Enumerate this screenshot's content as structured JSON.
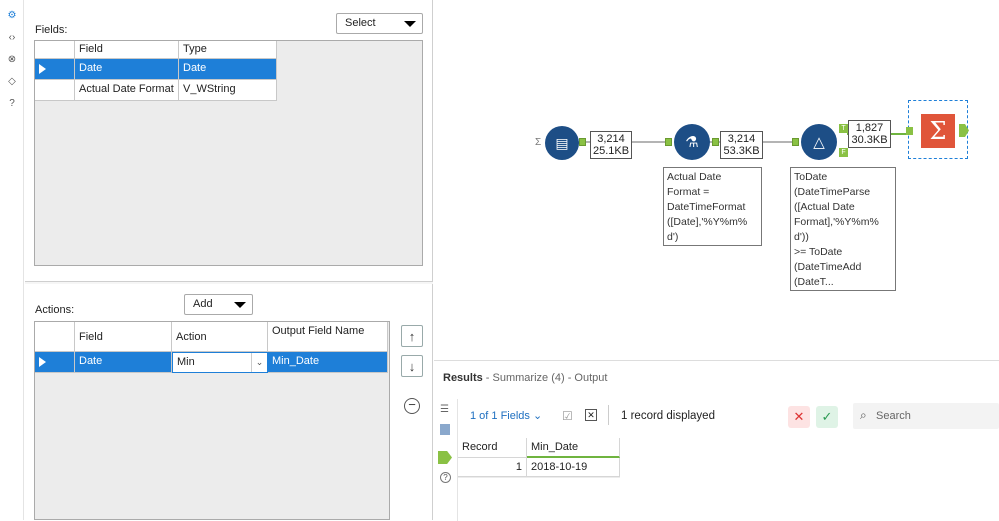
{
  "left_panel": {
    "fields_label": "Fields:",
    "select_dropdown": "Select",
    "fields_table": {
      "headers": [
        "Field",
        "Type"
      ],
      "rows": [
        {
          "field": "Date",
          "type": "Date"
        },
        {
          "field": "Actual Date Format",
          "type": "V_WString"
        }
      ]
    },
    "actions_label": "Actions:",
    "add_dropdown": "Add",
    "actions_table": {
      "headers": [
        "Field",
        "Action",
        "Output Field Name"
      ],
      "rows": [
        {
          "field": "Date",
          "action": "Min",
          "output": "Min_Date"
        }
      ]
    }
  },
  "canvas": {
    "conn1": {
      "line1": "3,214",
      "line2": "25.1KB"
    },
    "conn2": {
      "line1": "3,214",
      "line2": "53.3KB"
    },
    "conn3": {
      "line1": "1,827",
      "line2": "30.3KB"
    },
    "formula_annotation": "Actual Date\nFormat =\nDateTimeFormat\n([Date],'%Y%m%\nd')",
    "filter_annotation": "ToDate\n(DateTimeParse\n([Actual Date\nFormat],'%Y%m%\nd'))\n>= ToDate\n(DateTimeAdd\n(DateT...",
    "filter_t": "T",
    "filter_f": "F"
  },
  "results": {
    "title": "Results",
    "subtitle": " - Summarize (4) - Output",
    "fields_filter": "1 of 1 Fields",
    "records_displayed": "1 record displayed",
    "search_placeholder": "Search",
    "table": {
      "headers": [
        "Record",
        "Min_Date"
      ],
      "rows": [
        {
          "record": "1",
          "min_date": "2018-10-19"
        }
      ]
    }
  },
  "colors": {
    "accent": "#1e7fd8",
    "tool_blue": "#1d4e86",
    "summarize_red": "#e0553a",
    "anchor_green": "#8ac144"
  }
}
